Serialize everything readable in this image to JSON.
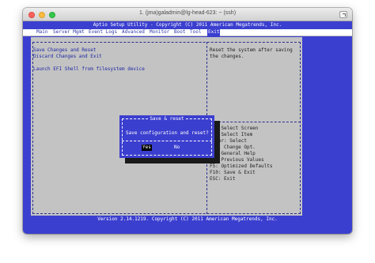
{
  "window": {
    "title": "1. (jma)galadmin@lg-head-623: ~ (ssh)"
  },
  "bios": {
    "header": "Aptio Setup Utility - Copyright (C) 2011 American Megatrends, Inc.",
    "tabs": [
      {
        "label": "Main",
        "active": false
      },
      {
        "label": "Server Mgmt",
        "active": false
      },
      {
        "label": "Event Logs",
        "active": false
      },
      {
        "label": "Advanced",
        "active": false
      },
      {
        "label": "Monitor",
        "active": false
      },
      {
        "label": "Boot",
        "active": false
      },
      {
        "label": "Tool",
        "active": false
      },
      {
        "label": "Exit",
        "active": true
      }
    ],
    "left_items": [
      "Save Changes and Reset",
      "Discard Changes and Exit",
      "Launch EFI Shell from filesystem device"
    ],
    "help_text": [
      "Reset the system after saving",
      "the changes."
    ],
    "key_help": [
      "><: Select Screen",
      "^v: Select Item",
      "Enter: Select",
      "+/-: Change Opt.",
      "F1: General Help",
      "F2: Previous Values",
      "F5: Optimized Defaults",
      "F10: Save & Exit",
      "ESC: Exit"
    ],
    "footer": "Version 2.14.1219. Copyright (C) 2011 American Megatrends, Inc."
  },
  "dialog": {
    "title": "Save & reset",
    "message": "Save configuration and reset?",
    "yes_label": "Yes",
    "no_label": "No",
    "selected": "Yes"
  },
  "colors": {
    "terminal_bg": "#3b3fcf",
    "panel_bg": "#c3c3c3",
    "menubar_bg": "#ffffff",
    "highlight_text": "#1f28a3"
  }
}
